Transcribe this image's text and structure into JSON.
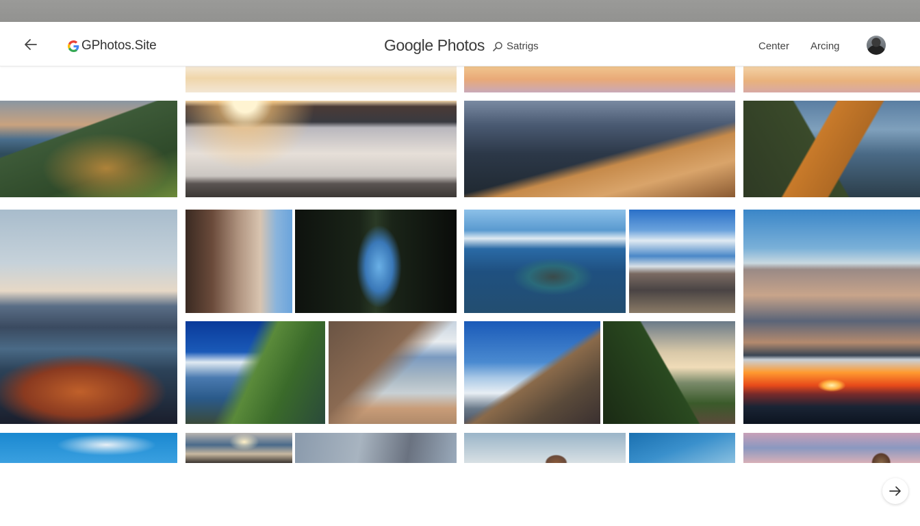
{
  "header": {
    "back_icon": "arrow-left-icon",
    "brand_icon": "google-g-icon",
    "brand_label": "GPhotos.Site",
    "title": "Google Photos",
    "settings_icon": "search-icon",
    "settings_label": "Satrigs",
    "nav_links": [
      "Center",
      "Arcing"
    ],
    "avatar": "user-avatar"
  },
  "gallery": {
    "photos": [
      {
        "id": "p1",
        "description": "Sunset clouds sky (partial)"
      },
      {
        "id": "p2",
        "description": "Orange pink sunset sky (partial)"
      },
      {
        "id": "p3",
        "description": "Warm dusk clouds (partial)"
      },
      {
        "id": "p4",
        "description": "Green ridge mountain with golden light"
      },
      {
        "id": "p5",
        "description": "Sunrise over calm bay with headlands"
      },
      {
        "id": "p6",
        "description": "Rocky mountain ridge at golden hour"
      },
      {
        "id": "p7",
        "description": "Sunlit orange mountain peak"
      },
      {
        "id": "p8",
        "description": "Lake and volcanic islands at dusk"
      },
      {
        "id": "p9",
        "description": "Sandstone canyon wall"
      },
      {
        "id": "p10",
        "description": "Stone arch bridge in dark canyon"
      },
      {
        "id": "p11",
        "description": "Aerial view of blue lake with volcano"
      },
      {
        "id": "p12",
        "description": "Snowy mountain range with clouds"
      },
      {
        "id": "p13",
        "description": "Mountain range above sunset lake"
      },
      {
        "id": "p14",
        "description": "Tower on green hilltop above clouds"
      },
      {
        "id": "p15",
        "description": "Coastal cliffs and beach under clouds"
      },
      {
        "id": "p16",
        "description": "Snow-capped peak under blue sky"
      },
      {
        "id": "p17",
        "description": "Winding road through green valley"
      },
      {
        "id": "p18",
        "description": "Blue sky with white clouds (partial)"
      },
      {
        "id": "p19",
        "description": "Sunset over sea with cliff (partial)"
      },
      {
        "id": "p20",
        "description": "Overcast grey sky (partial)"
      },
      {
        "id": "p21",
        "description": "Rocky peak at dawn (partial)"
      },
      {
        "id": "p22",
        "description": "Clear blue sky (partial)"
      },
      {
        "id": "p23",
        "description": "Pink clouds with peak (partial)"
      }
    ]
  },
  "pagination": {
    "next_icon": "arrow-right-icon"
  }
}
